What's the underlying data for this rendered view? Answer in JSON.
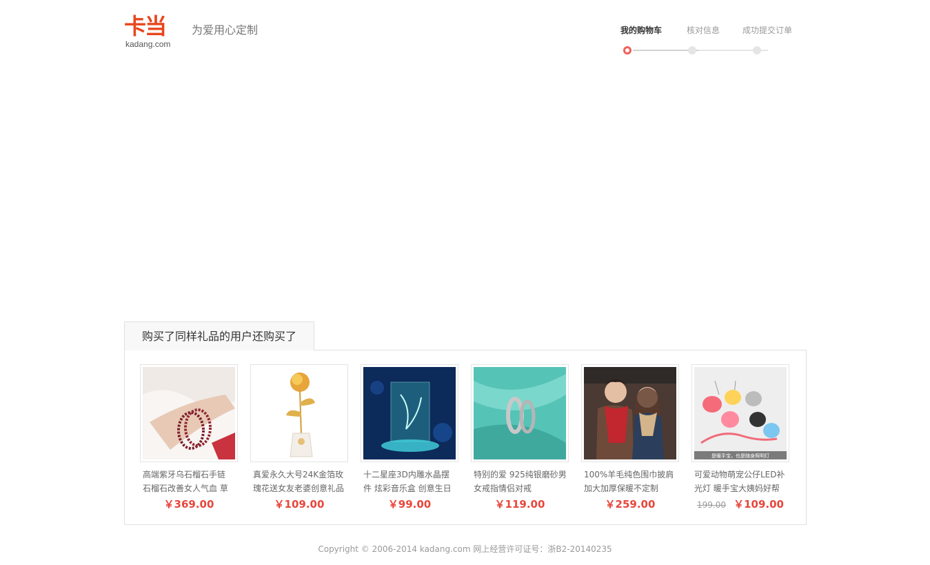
{
  "header": {
    "logo_text": "卡当",
    "logo_domain": "kadang.com",
    "slogan": "为爱用心定制"
  },
  "steps": [
    {
      "label": "我的购物车",
      "active": true
    },
    {
      "label": "核对信息",
      "active": false
    },
    {
      "label": "成功提交订单",
      "active": false
    }
  ],
  "recommend": {
    "title": "购买了同样礼品的用户还购买了",
    "products": [
      {
        "name": "高端紫牙乌石榴石手链 石榴石改善女人气血 草",
        "price": "￥369.00",
        "old_price": ""
      },
      {
        "name": "真爱永久大号24K金箔玫瑰花送女友老婆创意礼品",
        "price": "￥109.00",
        "old_price": ""
      },
      {
        "name": "十二星座3D内雕水晶摆件 炫彩音乐盒 创意生日",
        "price": "￥99.00",
        "old_price": ""
      },
      {
        "name": "特别的爱 925纯银磨砂男女戒指情侣对戒",
        "price": "￥119.00",
        "old_price": ""
      },
      {
        "name": "100%羊毛纯色围巾披肩加大加厚保暖不定制",
        "price": "￥259.00",
        "old_price": ""
      },
      {
        "name": "可爱动物萌宠公仔LED补光灯 暖手宝大姨妈好帮",
        "price": "￥109.00",
        "old_price": "199.00"
      }
    ],
    "banner_caption": "是暖手宝，也是随身照明灯"
  },
  "footer": {
    "text": "Copyright  ©  2006-2014  kadang.com  网上经营许可证号：浙B2-20140235"
  }
}
